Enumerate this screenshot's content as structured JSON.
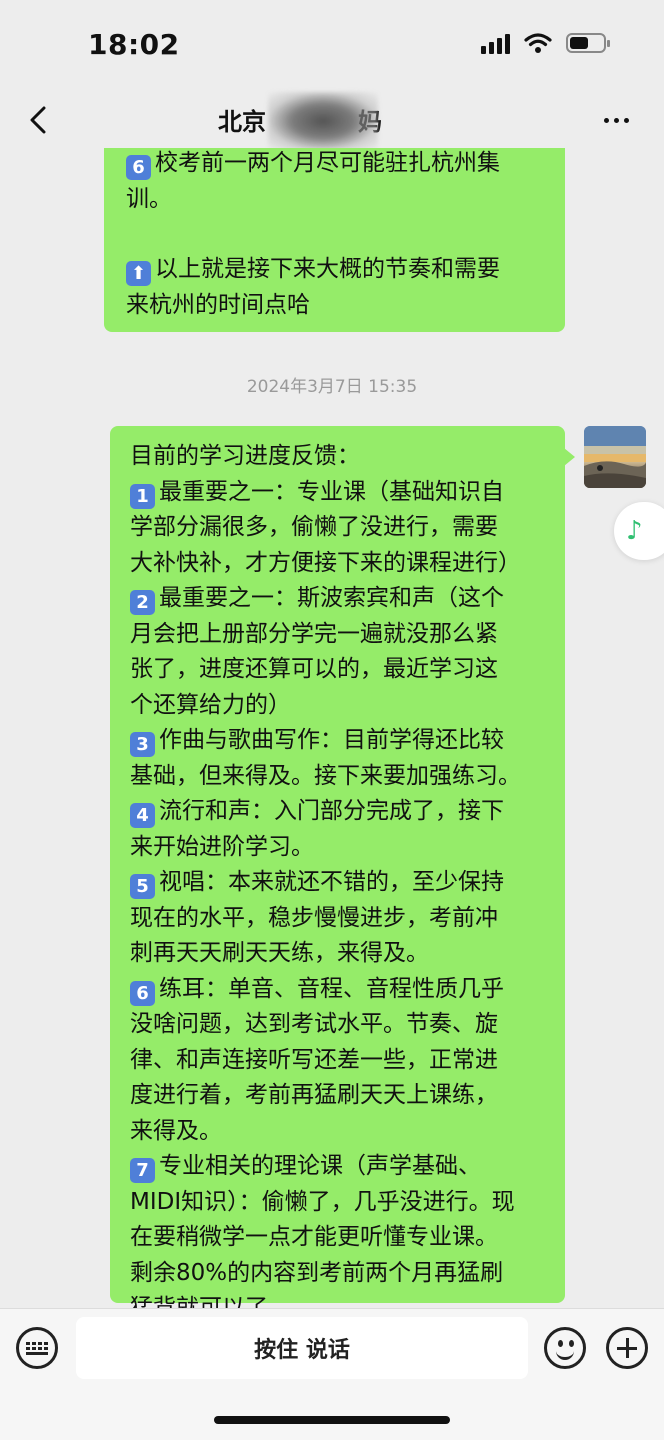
{
  "status_bar": {
    "time": "18:02",
    "battery_fill": 0.5
  },
  "nav": {
    "back_icon": "chevron-left-icon",
    "title_visible": "北京",
    "title_suffix": "妈",
    "more_icon": "more-icon"
  },
  "messages": [
    {
      "lines": [
        {
          "badge": "6",
          "text": "校考前一两个月尽可能驻扎杭州集"
        },
        {
          "text": "训。"
        },
        {
          "gap": true
        },
        {
          "badge_icon": "up-arrow",
          "text": "以上就是接下来大概的节奏和需要"
        },
        {
          "text": "来杭州的时间点哈"
        }
      ]
    },
    {
      "timestamp": "2024年3月7日 15:35",
      "lines": [
        {
          "text": "目前的学习进度反馈："
        },
        {
          "badge": "1",
          "text": "最重要之一：专业课（基础知识自"
        },
        {
          "text": "学部分漏很多，偷懒了没进行，需要"
        },
        {
          "text": "大补快补，才方便接下来的课程进行）"
        },
        {
          "badge": "2",
          "text": "最重要之一：斯波索宾和声（这个"
        },
        {
          "text": "月会把上册部分学完一遍就没那么紧"
        },
        {
          "text": "张了，进度还算可以的，最近学习这"
        },
        {
          "text": "个还算给力的）"
        },
        {
          "badge": "3",
          "text": "作曲与歌曲写作：目前学得还比较"
        },
        {
          "text": "基础，但来得及。接下来要加强练习。"
        },
        {
          "badge": "4",
          "text": "流行和声：入门部分完成了，接下"
        },
        {
          "text": "来开始进阶学习。"
        },
        {
          "badge": "5",
          "text": "视唱：本来就还不错的，至少保持"
        },
        {
          "text": "现在的水平，稳步慢慢进步，考前冲"
        },
        {
          "text": "刺再天天刷天天练，来得及。"
        },
        {
          "badge": "6",
          "text": "练耳：单音、音程、音程性质几乎"
        },
        {
          "text": "没啥问题，达到考试水平。节奏、旋"
        },
        {
          "text": "律、和声连接听写还差一些，正常进"
        },
        {
          "text": "度进行着，考前再猛刷天天上课练，"
        },
        {
          "text": "来得及。"
        },
        {
          "badge": "7",
          "text": "专业相关的理论课（声学基础、"
        },
        {
          "text": "MIDI知识）：偷懒了，几乎没进行。现"
        },
        {
          "text": "在要稍微学一点才能更听懂专业课。"
        },
        {
          "text": "剩余80%的内容到考前两个月再猛刷"
        },
        {
          "text": "猛背就可以了。"
        }
      ]
    }
  ],
  "floating": {
    "icon": "music-note-icon",
    "glyph": "♪"
  },
  "input_bar": {
    "voice_label": "按住 说话"
  }
}
